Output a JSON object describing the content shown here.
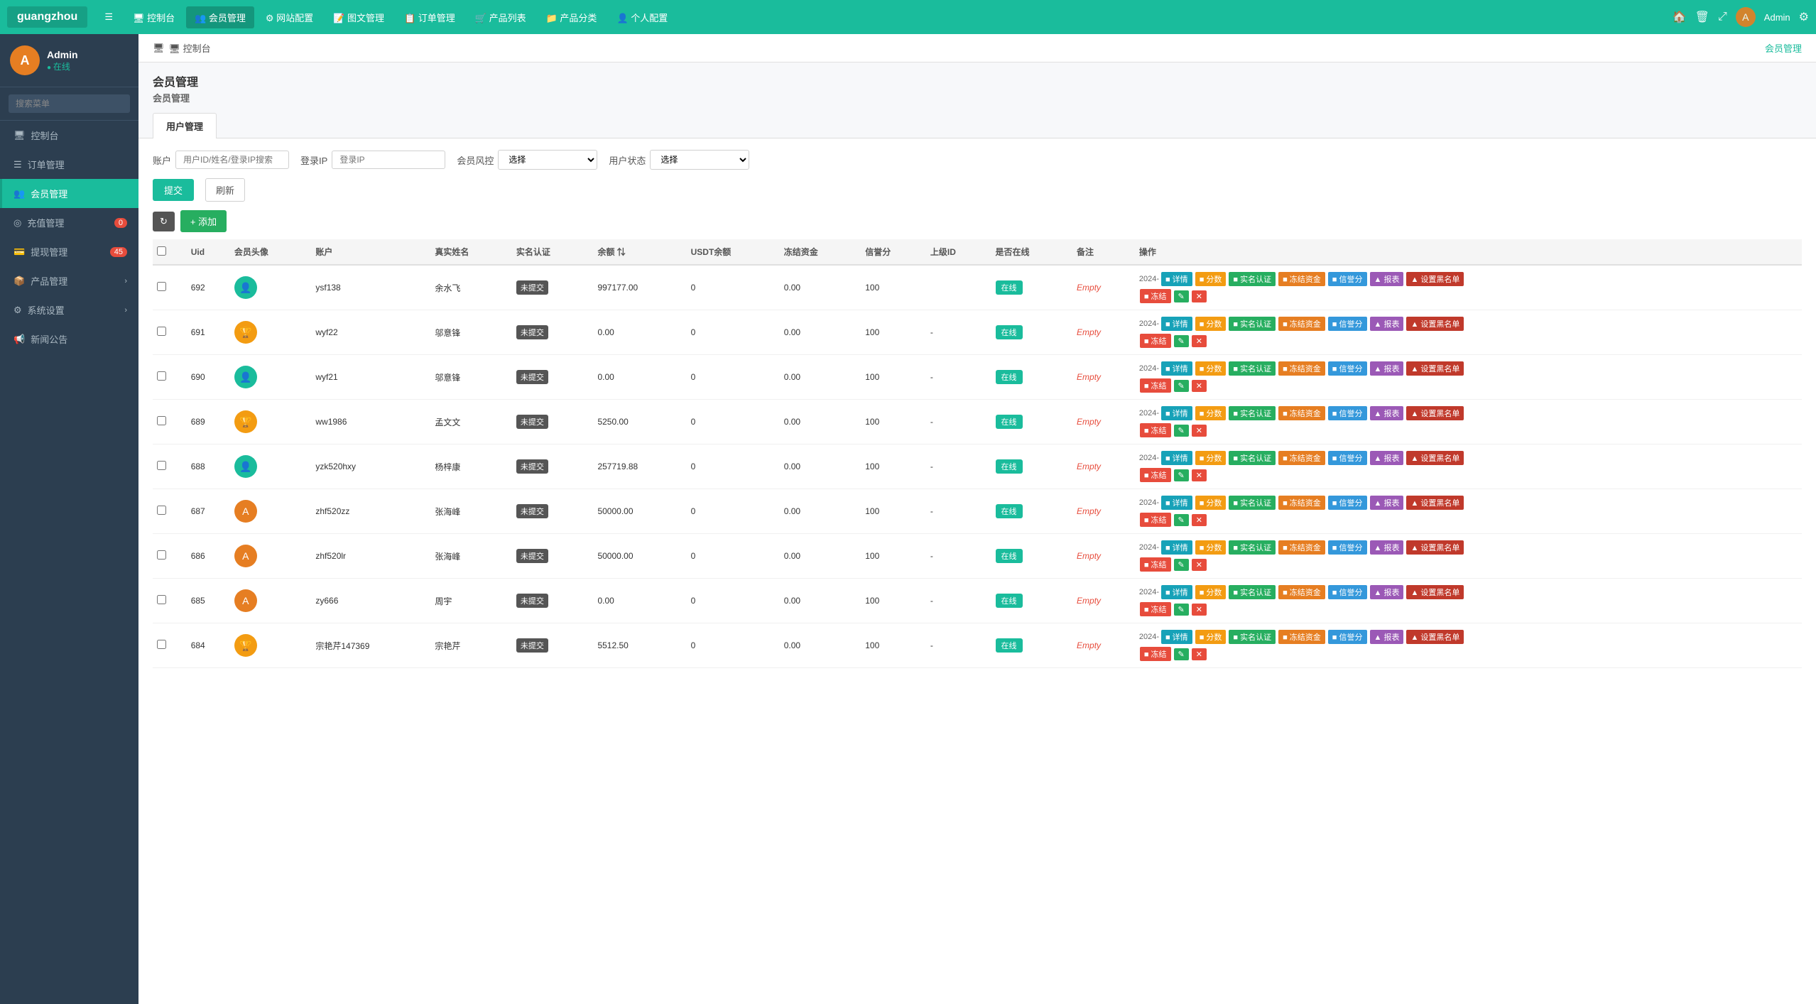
{
  "app": {
    "logo": "guangzhou",
    "admin_name": "Admin"
  },
  "top_nav": {
    "items": [
      {
        "id": "menu-icon",
        "label": "☰",
        "icon": true
      },
      {
        "id": "dashboard",
        "label": "控制台",
        "icon": "🖥"
      },
      {
        "id": "member",
        "label": "会员管理",
        "icon": "👥",
        "active": true
      },
      {
        "id": "site-config",
        "label": "网站配置",
        "icon": "⚙"
      },
      {
        "id": "article",
        "label": "图文管理",
        "icon": "📝"
      },
      {
        "id": "order",
        "label": "订单管理",
        "icon": "📋"
      },
      {
        "id": "product-list",
        "label": "产品列表",
        "icon": "🛒"
      },
      {
        "id": "product-cat",
        "label": "产品分类",
        "icon": "📁"
      },
      {
        "id": "personal",
        "label": "个人配置",
        "icon": "👤"
      }
    ],
    "right_icons": [
      "🏠",
      "🗑",
      "⤢",
      "⚙"
    ]
  },
  "sidebar": {
    "user": {
      "name": "Admin",
      "status": "在线",
      "avatar_letter": "A"
    },
    "search_placeholder": "搜索菜单",
    "menu": [
      {
        "id": "dashboard",
        "label": "控制台",
        "icon": "🖥",
        "active": false
      },
      {
        "id": "order",
        "label": "订单管理",
        "icon": "☰",
        "active": false
      },
      {
        "id": "member",
        "label": "会员管理",
        "icon": "👥",
        "active": true
      },
      {
        "id": "recharge",
        "label": "充值管理",
        "icon": "◎",
        "badge": "0",
        "active": false
      },
      {
        "id": "withdraw",
        "label": "提现管理",
        "icon": "💳",
        "badge": "45",
        "active": false
      },
      {
        "id": "product",
        "label": "产品管理",
        "icon": "📦",
        "arrow": "›",
        "active": false
      },
      {
        "id": "system",
        "label": "系统设置",
        "icon": "⚙",
        "arrow": "›",
        "active": false
      },
      {
        "id": "news",
        "label": "新闻公告",
        "icon": "📢",
        "active": false
      }
    ]
  },
  "breadcrumb": {
    "left": "🖥 控制台",
    "right": "会员管理"
  },
  "page_header": {
    "title": "会员管理",
    "subtitle": "会员管理"
  },
  "tabs": [
    {
      "id": "user-manage",
      "label": "用户管理",
      "active": true
    }
  ],
  "filter": {
    "account_label": "账户",
    "account_placeholder": "用户ID/姓名/登录IP搜索",
    "login_ip_label": "登录IP",
    "login_ip_placeholder": "登录IP",
    "risk_label": "会员风控",
    "risk_placeholder": "选择",
    "status_label": "用户状态",
    "status_placeholder": "选择",
    "submit_btn": "提交",
    "refresh_btn": "刷新"
  },
  "toolbar": {
    "refresh_icon": "↻",
    "add_btn": "+ 添加"
  },
  "table": {
    "columns": [
      "",
      "Uid",
      "会员头像",
      "账户",
      "真实姓名",
      "实名认证",
      "余额",
      "USDT余额",
      "冻结资金",
      "信誉分",
      "上级ID",
      "是否在线",
      "备注",
      "操作"
    ],
    "rows": [
      {
        "uid": "692",
        "avatar_color": "#1abc9c",
        "avatar_letter": "👤",
        "account": "ysf138",
        "real_name": "余水飞",
        "verify_status": "未提交",
        "balance": "997177.00",
        "usdt": "0",
        "frozen": "0.00",
        "credit": "100",
        "parent_id": "",
        "online": "在线",
        "note": "Empty",
        "date": "2024-"
      },
      {
        "uid": "691",
        "avatar_color": "#f39c12",
        "avatar_letter": "🏆",
        "account": "wyf22",
        "real_name": "邬意锋",
        "verify_status": "未提交",
        "balance": "0.00",
        "usdt": "0",
        "frozen": "0.00",
        "credit": "100",
        "parent_id": "-",
        "online": "在线",
        "note": "Empty",
        "date": "2024-"
      },
      {
        "uid": "690",
        "avatar_color": "#1abc9c",
        "avatar_letter": "👤",
        "account": "wyf21",
        "real_name": "邬意锋",
        "verify_status": "未提交",
        "balance": "0.00",
        "usdt": "0",
        "frozen": "0.00",
        "credit": "100",
        "parent_id": "-",
        "online": "在线",
        "note": "Empty",
        "date": "2024-"
      },
      {
        "uid": "689",
        "avatar_color": "#f39c12",
        "avatar_letter": "🏆",
        "account": "ww1986",
        "real_name": "孟文文",
        "verify_status": "未提交",
        "balance": "5250.00",
        "usdt": "0",
        "frozen": "0.00",
        "credit": "100",
        "parent_id": "-",
        "online": "在线",
        "note": "Empty",
        "date": "2024-"
      },
      {
        "uid": "688",
        "avatar_color": "#1abc9c",
        "avatar_letter": "👤",
        "account": "yzk520hxy",
        "real_name": "杨梓康",
        "verify_status": "未提交",
        "balance": "257719.88",
        "usdt": "0",
        "frozen": "0.00",
        "credit": "100",
        "parent_id": "-",
        "online": "在线",
        "note": "Empty",
        "date": "2024-"
      },
      {
        "uid": "687",
        "avatar_color": "#e67e22",
        "avatar_letter": "A",
        "account": "zhf520zz",
        "real_name": "张海峰",
        "verify_status": "未提交",
        "balance": "50000.00",
        "usdt": "0",
        "frozen": "0.00",
        "credit": "100",
        "parent_id": "-",
        "online": "在线",
        "note": "Empty",
        "date": "2024-"
      },
      {
        "uid": "686",
        "avatar_color": "#e67e22",
        "avatar_letter": "A",
        "account": "zhf520lr",
        "real_name": "张海峰",
        "verify_status": "未提交",
        "balance": "50000.00",
        "usdt": "0",
        "frozen": "0.00",
        "credit": "100",
        "parent_id": "-",
        "online": "在线",
        "note": "Empty",
        "date": "2024-"
      },
      {
        "uid": "685",
        "avatar_color": "#e67e22",
        "avatar_letter": "A",
        "account": "zy666",
        "real_name": "周宇",
        "verify_status": "未提交",
        "balance": "0.00",
        "usdt": "0",
        "frozen": "0.00",
        "credit": "100",
        "parent_id": "-",
        "online": "在线",
        "note": "Empty",
        "date": "2024-"
      },
      {
        "uid": "684",
        "avatar_color": "#f39c12",
        "avatar_letter": "🏆",
        "account": "宗艳芹147369",
        "real_name": "宗艳芹",
        "verify_status": "未提交",
        "balance": "5512.50",
        "usdt": "0",
        "frozen": "0.00",
        "credit": "100",
        "parent_id": "-",
        "online": "在线",
        "note": "Empty",
        "date": "2024-"
      }
    ],
    "action_buttons": [
      {
        "label": "■ 详情",
        "class": "btn-detail"
      },
      {
        "label": "■ 分数",
        "class": "btn-score"
      },
      {
        "label": "■ 实名认证",
        "class": "btn-verify"
      },
      {
        "label": "■ 冻结资金",
        "class": "btn-freeze-funds"
      },
      {
        "label": "■ 信誉分",
        "class": "btn-credit"
      },
      {
        "label": "■ 报表",
        "class": "btn-report"
      },
      {
        "label": "▲ 设置黑名单",
        "class": "btn-blacklist"
      },
      {
        "label": "■ 冻结",
        "class": "btn-freeze"
      },
      {
        "label": "✎",
        "class": "btn-edit"
      },
      {
        "label": "✕",
        "class": "btn-delete"
      }
    ]
  }
}
